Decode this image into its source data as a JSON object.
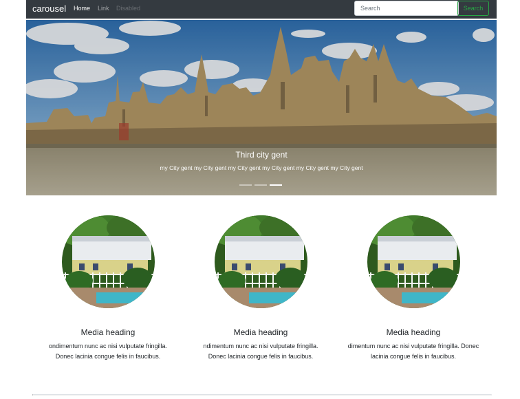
{
  "navbar": {
    "brand": "carousel",
    "links": [
      {
        "label": "Home",
        "state": "active"
      },
      {
        "label": "Link",
        "state": "normal"
      },
      {
        "label": "Disabled",
        "state": "disabled"
      }
    ],
    "search_placeholder": "Search",
    "search_button": "Search"
  },
  "carousel": {
    "title": "Third city gent",
    "text": "my City gent my City gent my City gent my City gent my City gent my City gent",
    "slide_count": 3,
    "active_slide": 3
  },
  "media_items": [
    {
      "heading": "Media heading",
      "line1": "ondimentum nunc ac nisi vulputate fringilla.",
      "line2": "Donec lacinia congue felis in faucibus."
    },
    {
      "heading": "Media heading",
      "line1": "ndimentum nunc ac nisi vulputate fringilla.",
      "line2": "Donec lacinia congue felis in faucibus."
    },
    {
      "heading": "Media heading",
      "line1": "dimentum nunc ac nisi vulputate fringilla. Donec",
      "line2": "lacinia congue felis in faucibus."
    }
  ],
  "colors": {
    "navbar_bg": "#343a40",
    "success": "#28a745",
    "sky": "#3a78b8",
    "stone": "#b0956a"
  }
}
